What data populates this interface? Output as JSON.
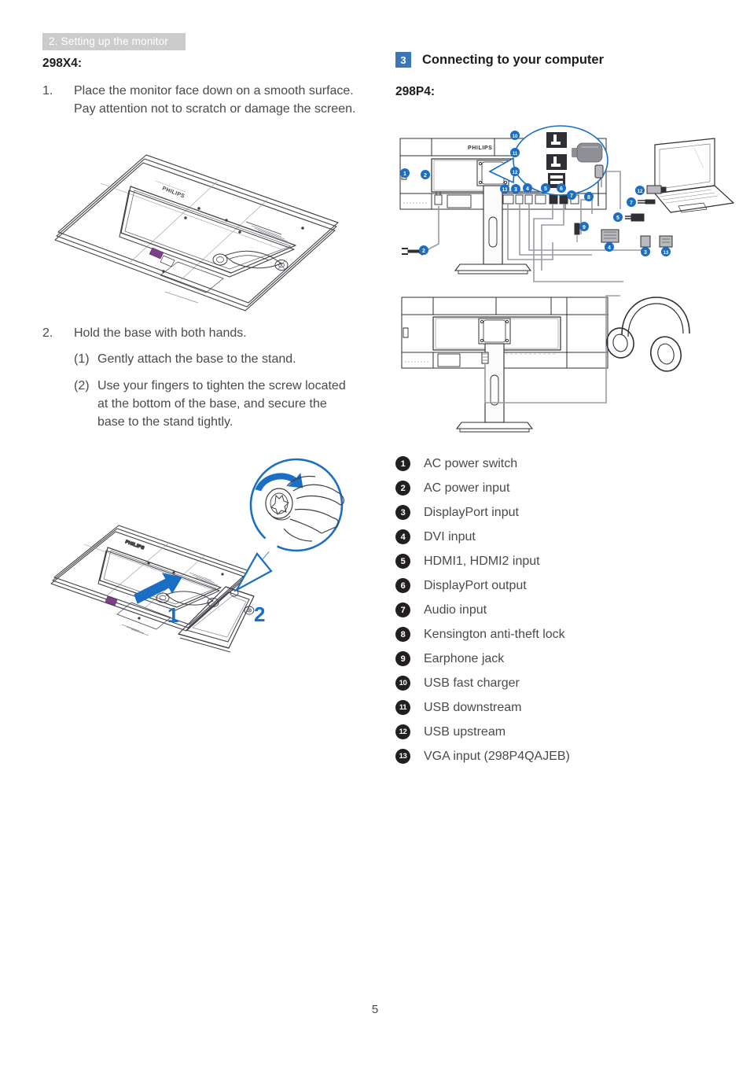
{
  "header": {
    "chapter": "2. Setting up the monitor"
  },
  "page": {
    "number": "5"
  },
  "left": {
    "model": "298X4:",
    "steps": [
      {
        "num": "1.",
        "text": "Place the monitor face down on a smooth surface. Pay attention not to scratch or damage the screen."
      },
      {
        "num": "2.",
        "text": "Hold the base with both hands."
      }
    ],
    "substeps": [
      {
        "num": "(1)",
        "text": "Gently attach the base to the stand."
      },
      {
        "num": "(2)",
        "text": "Use your fingers to tighten the screw located at the bottom of the base, and secure the base to the stand tightly."
      }
    ],
    "figure_1": {
      "name": "monitor-face-down-illustration",
      "brand": "PHILIPS"
    },
    "figure_2": {
      "name": "attach-base-illustration",
      "brand": "PHILIPS",
      "markers": [
        "1",
        "2"
      ],
      "magnifier": "screw-tighten-detail"
    }
  },
  "right": {
    "section_number": "3",
    "section_title": "Connecting to your computer",
    "model": "298P4:",
    "figure_top": {
      "name": "monitor-rear-connections-diagram",
      "brand": "PHILIPS",
      "callout_bubble_items": [
        "10",
        "11",
        "12"
      ],
      "port_callouts": [
        "13",
        "3",
        "4",
        "5",
        "6",
        "7",
        "8",
        "9"
      ],
      "power_callouts": [
        "1",
        "2"
      ],
      "cable_callouts": [
        "12",
        "7",
        "5",
        "4",
        "3",
        "13",
        "9"
      ]
    },
    "figure_bottom": {
      "name": "monitor-rear-earphone-diagram",
      "accessory": "headphones"
    },
    "legend": [
      {
        "num": "1",
        "label": "AC power switch"
      },
      {
        "num": "2",
        "label": "AC power input"
      },
      {
        "num": "3",
        "label": "DisplayPort input"
      },
      {
        "num": "4",
        "label": "DVI input"
      },
      {
        "num": "5",
        "label": "HDMI1, HDMI2 input"
      },
      {
        "num": "6",
        "label": "DisplayPort output"
      },
      {
        "num": "7",
        "label": "Audio input"
      },
      {
        "num": "8",
        "label": "Kensington anti-theft lock"
      },
      {
        "num": "9",
        "label": "Earphone jack"
      },
      {
        "num": "10",
        "label": "USB fast charger"
      },
      {
        "num": "11",
        "label": "USB downstream"
      },
      {
        "num": "12",
        "label": "USB upstream"
      },
      {
        "num": "13",
        "label": "VGA input (298P4QAJEB)"
      }
    ]
  },
  "colors": {
    "banner_bg": "#cccccc",
    "badge_blue": "#3a76b8",
    "badge_dark": "#231f20",
    "callout_blue": "#1a6fc4",
    "text": "#4a4a4a"
  }
}
